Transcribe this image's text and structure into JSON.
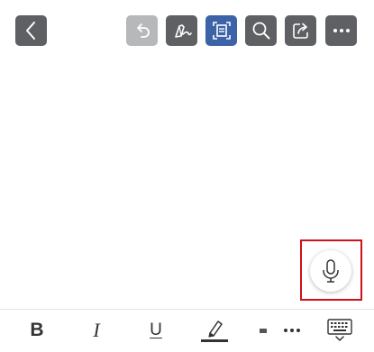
{
  "toolbar": {
    "buttons": [
      {
        "name": "back",
        "icon": "chevron-left-icon",
        "state": "normal"
      },
      {
        "name": "undo",
        "icon": "undo-icon",
        "state": "disabled"
      },
      {
        "name": "pen",
        "icon": "pen-sign-icon",
        "state": "normal"
      },
      {
        "name": "fit-page",
        "icon": "fit-page-icon",
        "state": "active"
      },
      {
        "name": "search",
        "icon": "search-icon",
        "state": "normal"
      },
      {
        "name": "share",
        "icon": "share-icon",
        "state": "normal"
      },
      {
        "name": "more",
        "icon": "more-horizontal-icon",
        "state": "normal"
      }
    ]
  },
  "mic": {
    "icon": "microphone-icon"
  },
  "format_bar": {
    "bold_label": "B",
    "italic_label": "I",
    "underline_label": "U",
    "highlight_icon": "highlighter-icon",
    "more_icon": "more-horizontal-icon",
    "keyboard_icon": "keyboard-hide-icon"
  },
  "colors": {
    "toolbar_button": "#5f6063",
    "toolbar_button_disabled": "#b7b8ba",
    "toolbar_button_active": "#3c63a7",
    "highlight_border": "#d0101b",
    "icon_dark": "#333333"
  }
}
